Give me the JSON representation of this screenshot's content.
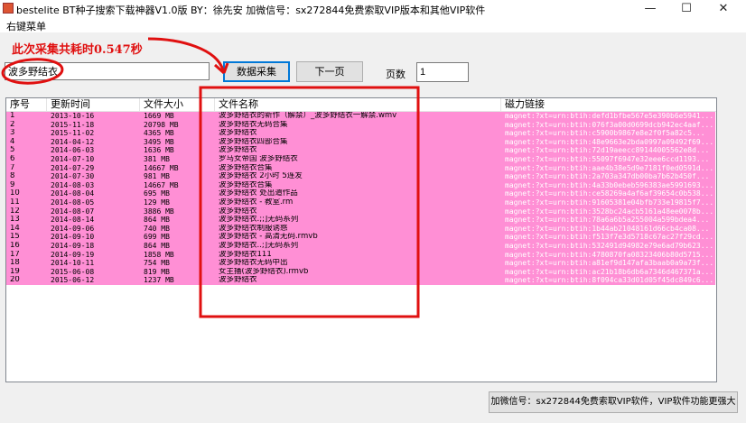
{
  "window": {
    "title": "bestelite BT种子搜索下载神器V1.0版  BY：徐先安   加微信号：sx272844免费索取VIP版本和其他VIP软件",
    "min_glyph": "—",
    "max_glyph": "☐",
    "close_glyph": "✕"
  },
  "menu": {
    "right_click": "右键菜单"
  },
  "status": {
    "timing": "此次采集共耗时0.547秒"
  },
  "search": {
    "value": "波多野结衣"
  },
  "toolbar": {
    "collect_label": "数据采集",
    "next_label": "下一页",
    "page_label": "页数",
    "page_value": "1"
  },
  "table": {
    "headers": [
      "序号",
      "更新时间",
      "文件大小",
      "文件名称",
      "磁力链接"
    ],
    "rows": [
      [
        "1",
        "2013-10-16",
        "1669 MB",
        "波多野结衣的新作（解禁）_波多野结衣一解禁.wmv",
        "magnet:?xt=urn:btih:defd1bfbe567e5e390b6e5941..."
      ],
      [
        "2",
        "2015-11-18",
        "20798 MB",
        "波多野结衣无码合集",
        "magnet:?xt=urn:btih:076f3a00d0699dcb942ec4aaf..."
      ],
      [
        "3",
        "2015-11-02",
        "4365 MB",
        "波多野结衣",
        "magnet:?xt=urn:btih:c5900b9867e8e2f0f5a82c5..."
      ],
      [
        "4",
        "2014-04-12",
        "3495 MB",
        "波多野结衣四部合集",
        "magnet:?xt=urn:btih:48e9663e2bda0997a09492f69..."
      ],
      [
        "5",
        "2014-06-03",
        "1636 MB",
        "波多野结衣",
        "magnet:?xt=urn:btih:72d19aeecc89144005562e8d..."
      ],
      [
        "6",
        "2014-07-10",
        "381 MB",
        "罗马女帝国 波多野结衣",
        "magnet:?xt=urn:btih:55097f6947e32eee6ccd1193..."
      ],
      [
        "7",
        "2014-07-29",
        "14667 MB",
        "波多野结衣合集",
        "magnet:?xt=urn:btih:aae4b38e5d9e7181f0ed0591d..."
      ],
      [
        "8",
        "2014-07-30",
        "981 MB",
        "波多野结衣 2小时 5连发",
        "magnet:?xt=urn:btih:2a703a347db00ba7b62b450f..."
      ],
      [
        "9",
        "2014-08-03",
        "14667 MB",
        "波多野结衣合集",
        "magnet:?xt=urn:btih:4a33b0ebeb596383ae5991693..."
      ],
      [
        "10",
        "2014-08-04",
        "695 MB",
        "波多野结衣 处出道作品",
        "magnet:?xt=urn:btih:ce58269a4af6af39654c0b538..."
      ],
      [
        "11",
        "2014-08-05",
        "129 MB",
        "波多野结衣 - 教室.rm",
        "magnet:?xt=urn:btih:91605381e04bfb733e19815f7..."
      ],
      [
        "12",
        "2014-08-07",
        "3886 MB",
        "波多野结衣",
        "magnet:?xt=urn:btih:3528bc24acb5161a48ee0078b..."
      ],
      [
        "13",
        "2014-08-14",
        "864 MB",
        "波多野结衣.;;]无码系列",
        "magnet:?xt=urn:btih:78a6a6b5a255004a599bdea4..."
      ],
      [
        "14",
        "2014-09-06",
        "740 MB",
        "波多野结衣制服诱惑",
        "magnet:?xt=urn:btih:1b44ab21048161d66cb4ca08..."
      ],
      [
        "15",
        "2014-09-10",
        "699 MB",
        "波多野结衣 - 高清无码.rmvb",
        "magnet:?xt=urn:btih:f513f7e3d5718c67ac27f29cd..."
      ],
      [
        "16",
        "2014-09-18",
        "864 MB",
        "波多野结衣..;]无码系列",
        "magnet:?xt=urn:btih:532491d94982e79e6ad79b623..."
      ],
      [
        "17",
        "2014-09-19",
        "1858 MB",
        "波多野结衣111",
        "magnet:?xt=urn:btih:4780870fa08323406b80d5715..."
      ],
      [
        "18",
        "2014-10-11",
        "754 MB",
        "波多野结衣无码中出",
        "magnet:?xt=urn:btih:a81ef9d147afa3baab0a9a73f..."
      ],
      [
        "19",
        "2015-06-08",
        "819 MB",
        "女主播(波多野结衣).rmvb",
        "magnet:?xt=urn:btih:ac21b18b6db6a7346d467371a..."
      ],
      [
        "20",
        "2015-06-12",
        "1237 MB",
        "波多野结衣",
        "magnet:?xt=urn:btih:8f094ca33d01d05f45dc849c6..."
      ]
    ]
  },
  "footer": {
    "label": "加微信号：sx272844免费索取VIP软件，VIP软件功能更强大"
  },
  "colors": {
    "row_bg": "#ff8fd5",
    "annotation_red": "#e01010",
    "button_focus": "#0078d7"
  }
}
